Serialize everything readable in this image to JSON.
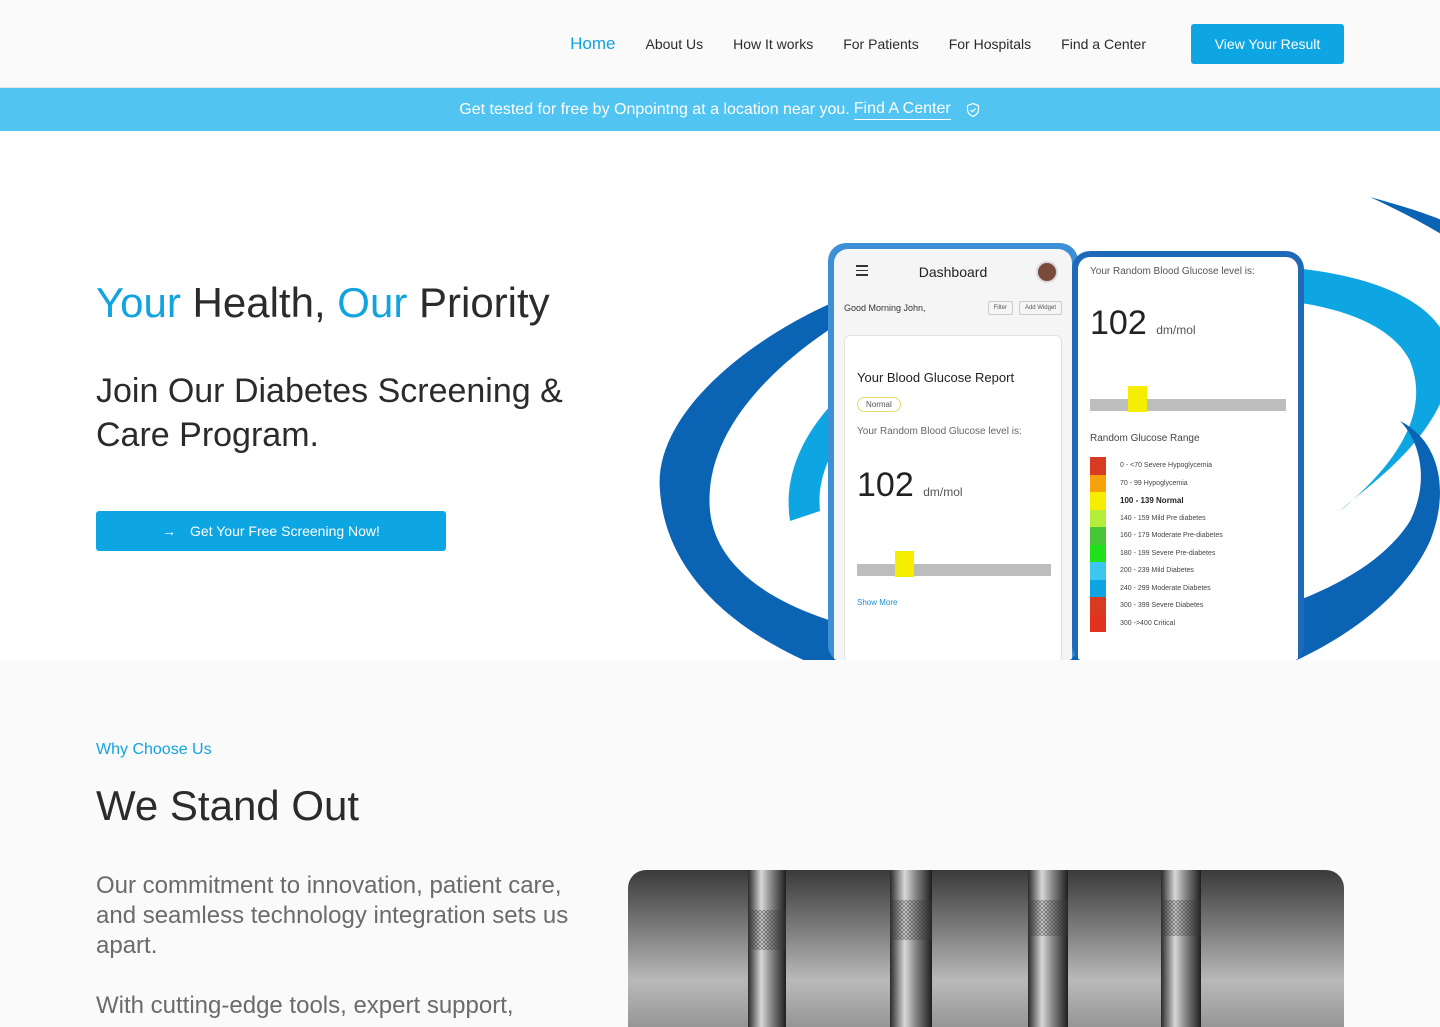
{
  "nav": {
    "links": [
      {
        "label": "Home",
        "active": true
      },
      {
        "label": "About Us"
      },
      {
        "label": "How It works"
      },
      {
        "label": "For Patients"
      },
      {
        "label": "For Hospitals"
      },
      {
        "label": "Find a Center"
      }
    ],
    "cta_label": "View Your Result"
  },
  "banner": {
    "text": "Get tested for free by Onpointng at a location near you.",
    "link_label": "Find A Center",
    "icon": "shield-check-icon"
  },
  "hero": {
    "title_word1": "Your",
    "title_word2": " Health, ",
    "title_word3": "Our",
    "title_word4": " Priority",
    "subtitle": "Join Our Diabetes Screening & Care Program.",
    "cta_label": "Get Your Free Screening Now!",
    "cta_icon": "arrow-right-icon"
  },
  "phone1": {
    "header": "Dashboard",
    "greeting": "Good Morning John,",
    "filter_label": "Filter",
    "add_widget_label": "Add Widget",
    "card_title": "Your Blood Glucose Report",
    "status": "Normal",
    "level_label": "Your Random Blood Glucose level is:",
    "value": "102",
    "unit": "dm/mol",
    "show_more": "Show More"
  },
  "phone2": {
    "level_label": "Your Random Blood Glucose level is:",
    "value": "102",
    "unit": "dm/mol",
    "range_title": "Random Glucose Range",
    "ranges": [
      {
        "text": "0    -  <70  Severe Hypoglycemia",
        "color": "#d93a22"
      },
      {
        "text": "70   -   99  Hypoglycemia",
        "color": "#f6a20a"
      },
      {
        "text": "100 - 139  Normal",
        "color": "#f6ee00",
        "bold": true
      },
      {
        "text": "140  -  159  Mild Pre diabetes",
        "color": "#b5ee3a"
      },
      {
        "text": "160  -  179  Moderate Pre-diabetes",
        "color": "#49c638"
      },
      {
        "text": "180  -  199  Severe Pre-diabetes",
        "color": "#1fe21a"
      },
      {
        "text": "200  -  239  Mild Diabetes",
        "color": "#3dc6ee"
      },
      {
        "text": "240  -  299  Moderate Diabetes",
        "color": "#0ea5e3"
      },
      {
        "text": "300  -  399  Severe Diabetes",
        "color": "#d93a22"
      },
      {
        "text": "300  ->400  Critical",
        "color": "#e3321e"
      }
    ]
  },
  "why": {
    "eyebrow": "Why Choose Us",
    "title": "We Stand Out",
    "p1": "Our commitment to innovation, patient care, and seamless technology integration sets us apart.",
    "p2": "With cutting-edge tools, expert support,"
  },
  "colors": {
    "accent": "#11a3e0",
    "button": "#0ea5e3",
    "banner": "#51c4f1",
    "ring_dark": "#0d62b3"
  }
}
